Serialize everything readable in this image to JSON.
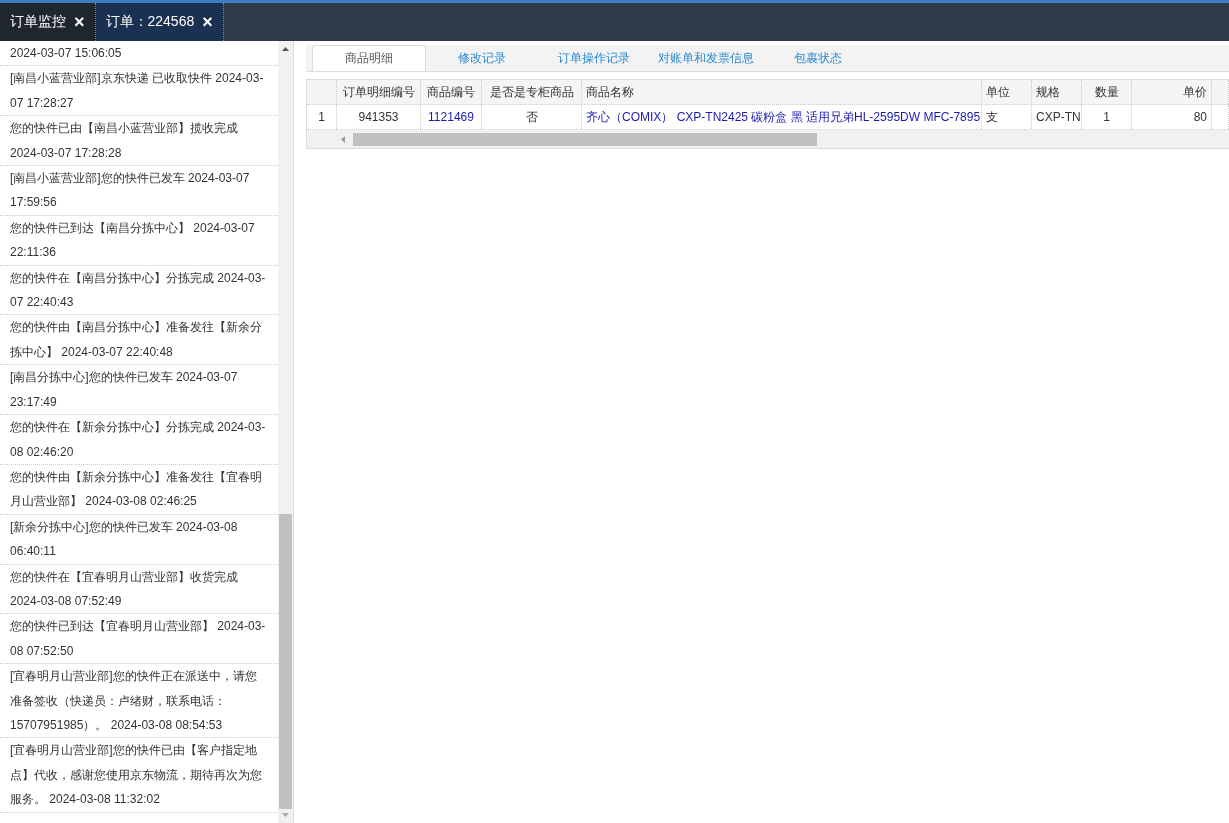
{
  "tabs": [
    {
      "label": "订单监控",
      "close": "×",
      "selected": false
    },
    {
      "label": "订单：224568",
      "close": "×",
      "selected": true
    }
  ],
  "tracking_log": [
    "2024-03-07 15:06:05",
    "[南昌小蓝营业部]京东快递 已收取快件 2024-03-07 17:28:27",
    "您的快件已由【南昌小蓝营业部】揽收完成 2024-03-07 17:28:28",
    "[南昌小蓝营业部]您的快件已发车 2024-03-07 17:59:56",
    "您的快件已到达【南昌分拣中心】 2024-03-07 22:11:36",
    "您的快件在【南昌分拣中心】分拣完成 2024-03-07 22:40:43",
    "您的快件由【南昌分拣中心】准备发往【新余分拣中心】 2024-03-07 22:40:48",
    "[南昌分拣中心]您的快件已发车 2024-03-07 23:17:49",
    "您的快件在【新余分拣中心】分拣完成 2024-03-08 02:46:20",
    "您的快件由【新余分拣中心】准备发往【宜春明月山营业部】 2024-03-08 02:46:25",
    "[新余分拣中心]您的快件已发车 2024-03-08 06:40:11",
    "您的快件在【宜春明月山营业部】收货完成 2024-03-08 07:52:49",
    "您的快件已到达【宜春明月山营业部】 2024-03-08 07:52:50",
    "[宜春明月山营业部]您的快件正在派送中，请您准备签收（快递员：卢绪财，联系电话：15707951985）。 2024-03-08 08:54:53",
    "[宜春明月山营业部]您的快件已由【客户指定地点】代收，感谢您使用京东物流，期待再次为您服务。 2024-03-08 11:32:02"
  ],
  "detail_tabs": [
    {
      "label": "商品明细",
      "selected": true
    },
    {
      "label": "修改记录",
      "selected": false
    },
    {
      "label": "订单操作记录",
      "selected": false
    },
    {
      "label": "对账单和发票信息",
      "selected": false
    },
    {
      "label": "包裹状态",
      "selected": false
    }
  ],
  "table": {
    "columns": [
      "订单明细编号",
      "商品编号",
      "是否是专柜商品",
      "商品名称",
      "单位",
      "规格",
      "数量",
      "单价"
    ],
    "rows": [
      {
        "number": "1",
        "cells": [
          {
            "text": "941353",
            "link": false
          },
          {
            "text": "1121469",
            "link": true
          },
          {
            "text": "否",
            "link": false
          },
          {
            "text": "齐心（COMIX） CXP-TN2425 碳粉盒 黑 适用兄弟HL-2595DW MFC-7895",
            "link": true
          },
          {
            "text": "支",
            "link": false
          },
          {
            "text": "CXP-TN",
            "link": false
          },
          {
            "text": "1",
            "link": false
          },
          {
            "text": "80",
            "link": false
          }
        ]
      }
    ]
  }
}
